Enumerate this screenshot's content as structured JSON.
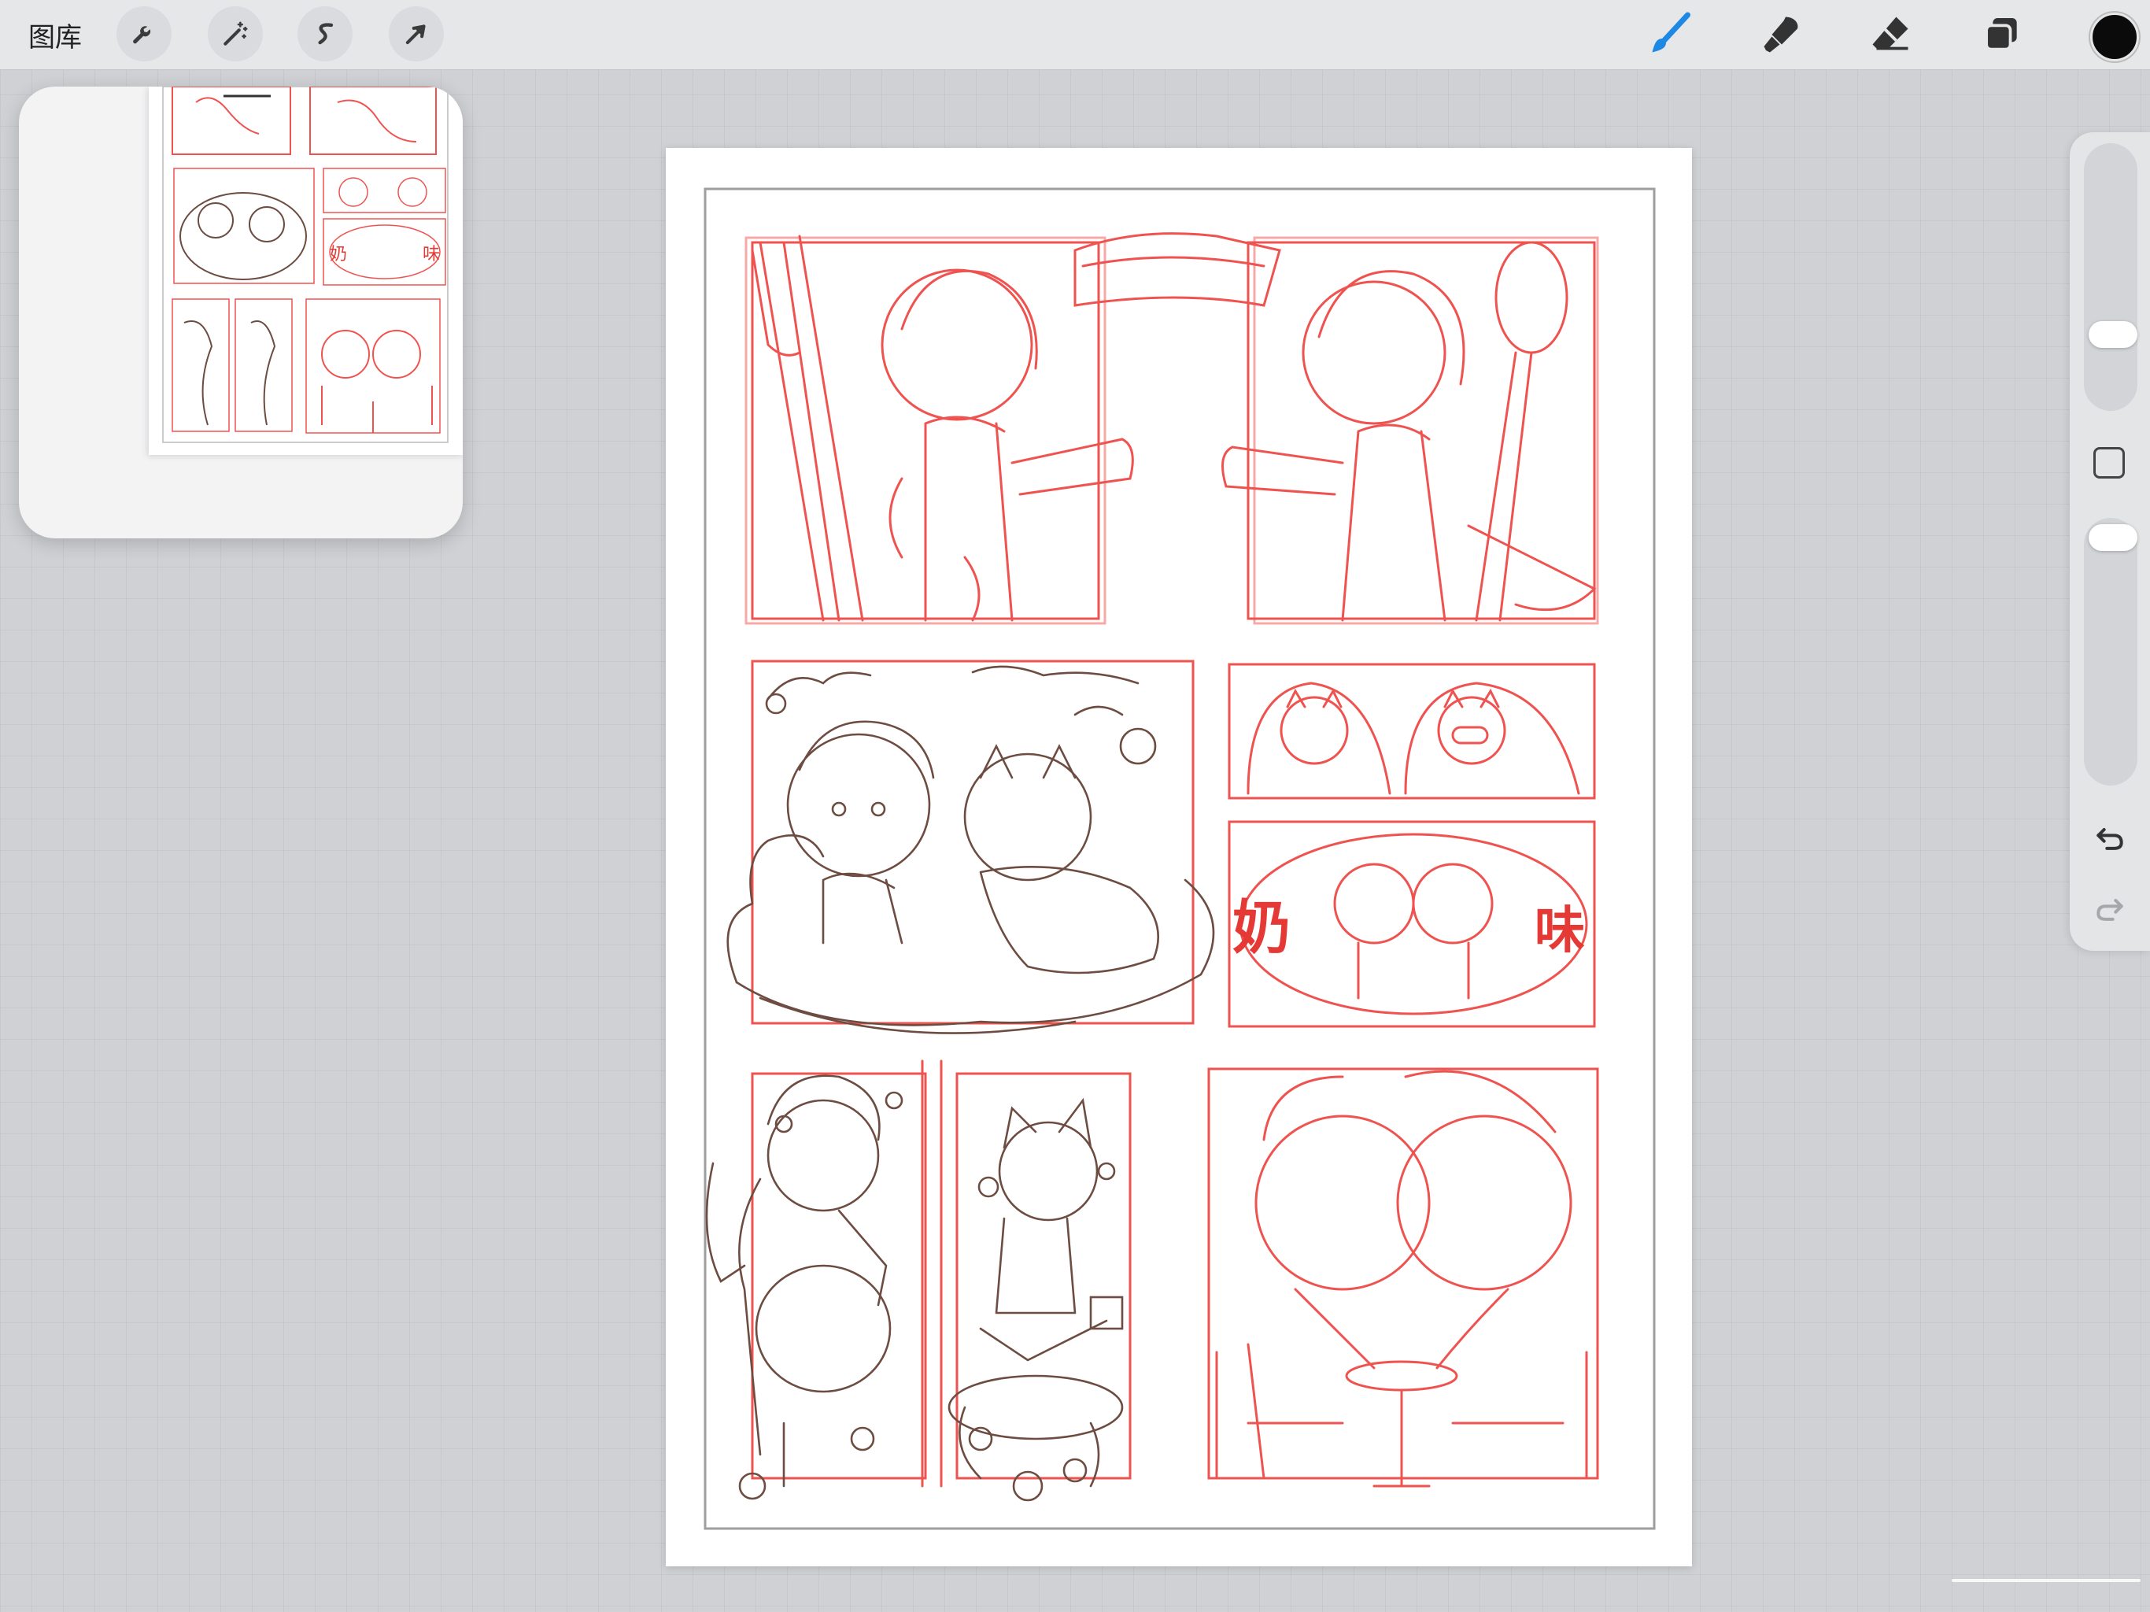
{
  "toolbar": {
    "gallery_label": "图库",
    "left_tools": [
      {
        "name": "actions",
        "icon": "wrench-icon"
      },
      {
        "name": "adjustments",
        "icon": "magic-wand-icon"
      },
      {
        "name": "selection",
        "icon": "selection-s-icon"
      },
      {
        "name": "transform",
        "icon": "arrow-cursor-icon"
      }
    ],
    "right_tools": [
      {
        "name": "brush",
        "icon": "brush-icon",
        "active": true
      },
      {
        "name": "smudge",
        "icon": "smudge-icon",
        "active": false
      },
      {
        "name": "eraser",
        "icon": "eraser-icon",
        "active": false
      },
      {
        "name": "layers",
        "icon": "layers-icon",
        "active": false
      }
    ],
    "current_color": "#0b0b0b",
    "active_tool_color": "#1e88e5"
  },
  "reference_window": {
    "content": "comic-page-thumbnail",
    "thumbnail_text": [
      "奶",
      "味"
    ]
  },
  "canvas": {
    "background": "#ffffff",
    "sketch_colors": {
      "rough": "#ef5350",
      "lineart": "#6d4c41"
    },
    "red_text": [
      "奶",
      "味"
    ]
  },
  "sidebar": {
    "brush_size_level": 0.27,
    "opacity_level": 0.02,
    "undo_icon": "undo-icon",
    "redo_icon": "redo-icon"
  }
}
